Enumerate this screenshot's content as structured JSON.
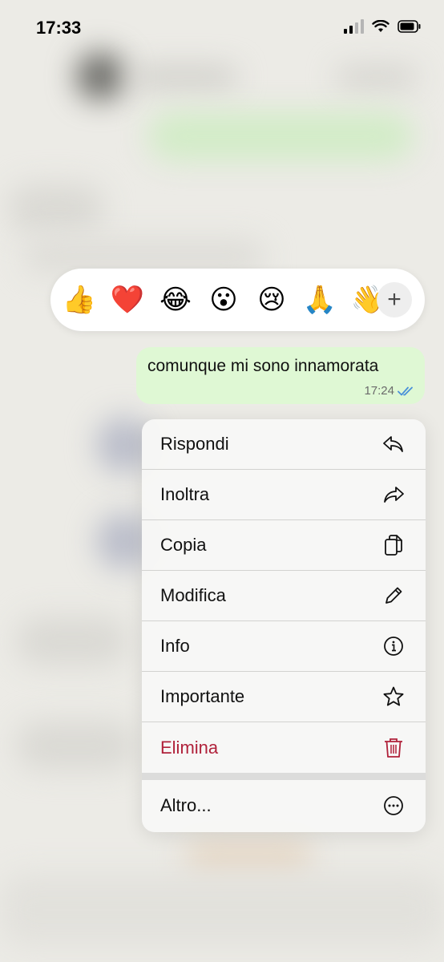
{
  "status_bar": {
    "time": "17:33"
  },
  "reaction_bar": {
    "reactions": [
      "👍",
      "❤️",
      "😂",
      "😮",
      "😢",
      "🙏",
      "👋"
    ],
    "more_label": "+"
  },
  "message": {
    "text": "comunque mi sono innamorata",
    "time": "17:24",
    "status": "read"
  },
  "menu": {
    "items": [
      {
        "label": "Rispondi",
        "icon": "reply-icon"
      },
      {
        "label": "Inoltra",
        "icon": "forward-icon"
      },
      {
        "label": "Copia",
        "icon": "copy-icon"
      },
      {
        "label": "Modifica",
        "icon": "pencil-icon"
      },
      {
        "label": "Info",
        "icon": "info-icon"
      },
      {
        "label": "Importante",
        "icon": "star-icon"
      },
      {
        "label": "Elimina",
        "icon": "trash-icon"
      }
    ],
    "more": {
      "label": "Altro...",
      "icon": "more-icon"
    }
  },
  "colors": {
    "bubble": "#dff8d4",
    "danger": "#b0213a",
    "read_ticks": "#4a90d9"
  }
}
